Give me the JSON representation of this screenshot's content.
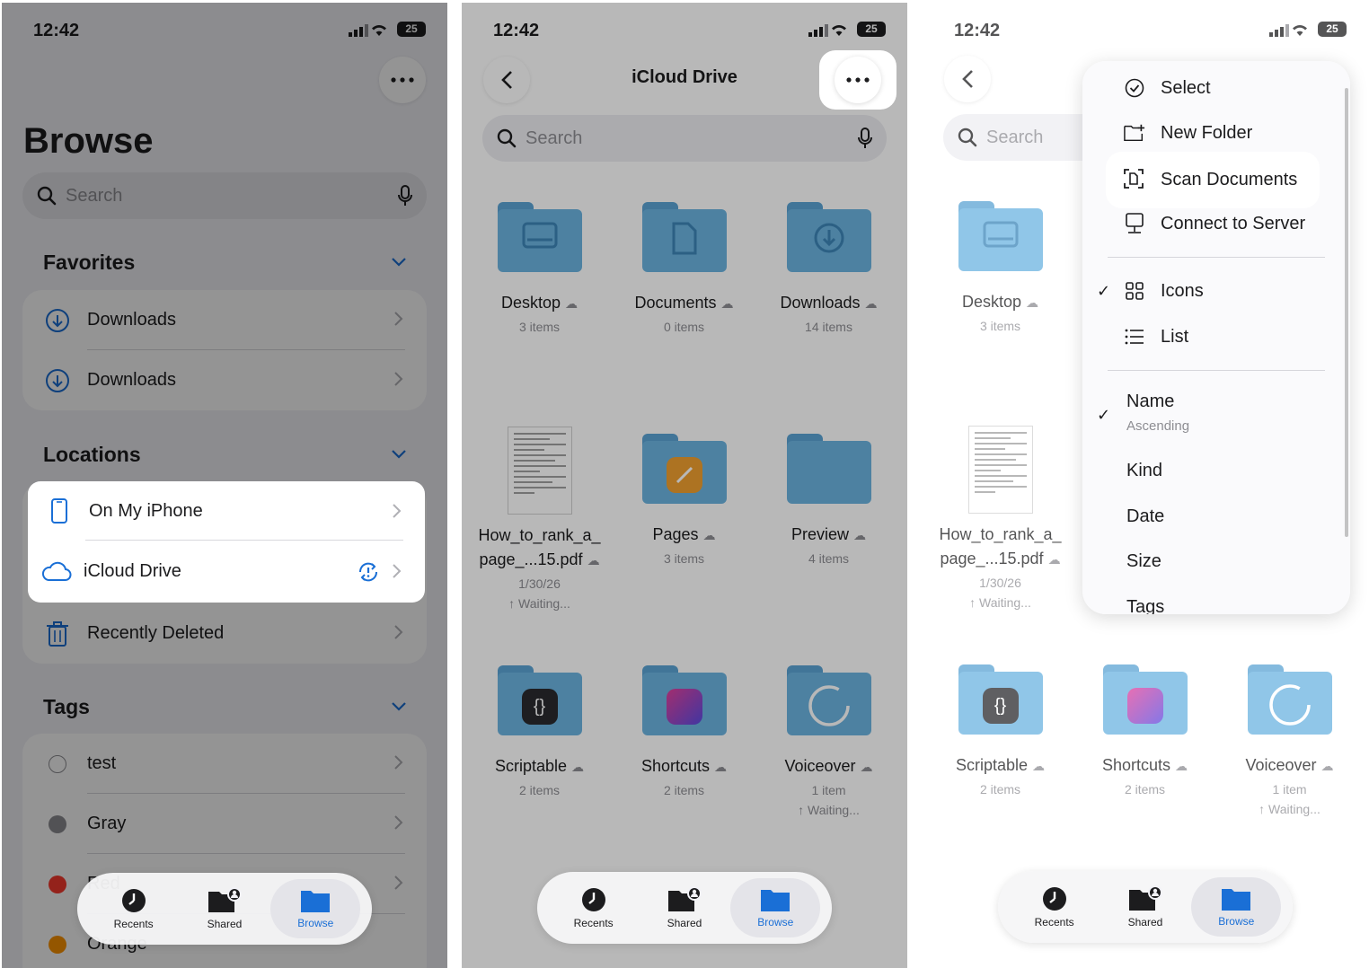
{
  "status": {
    "time": "12:42",
    "battery": "25"
  },
  "browse": {
    "title": "Browse",
    "search_placeholder": "Search",
    "favorites": {
      "heading": "Favorites",
      "items": [
        {
          "label": "Downloads"
        },
        {
          "label": "Downloads"
        }
      ]
    },
    "locations": {
      "heading": "Locations",
      "items": [
        {
          "label": "On My iPhone"
        },
        {
          "label": "iCloud Drive"
        },
        {
          "label": "Recently Deleted"
        }
      ]
    },
    "tags": {
      "heading": "Tags",
      "items": [
        {
          "label": "test",
          "color": "#ffffff"
        },
        {
          "label": "Gray",
          "color": "#8e8e93"
        },
        {
          "label": "Red",
          "color": "#ff3b30"
        },
        {
          "label": "Orange",
          "color": "#ff9500"
        }
      ]
    }
  },
  "tabbar": {
    "recents": "Recents",
    "shared": "Shared",
    "browse": "Browse"
  },
  "icloud": {
    "title": "iCloud Drive",
    "search_placeholder": "Search",
    "items": [
      {
        "name": "Desktop",
        "sub": "3 items"
      },
      {
        "name": "Documents",
        "sub": "0 items"
      },
      {
        "name": "Downloads",
        "sub": "14 items"
      },
      {
        "name_line1": "How_to_rank_a_",
        "name_line2": "page_...15.pdf",
        "date": "1/30/26",
        "status": "↑ Waiting..."
      },
      {
        "name": "Pages",
        "sub": "3 items"
      },
      {
        "name": "Preview",
        "sub": "4 items"
      },
      {
        "name": "Scriptable",
        "sub": "2 items"
      },
      {
        "name": "Shortcuts",
        "sub": "2 items"
      },
      {
        "name": "Voiceover",
        "sub": "1 item",
        "status": "↑ Waiting..."
      }
    ]
  },
  "menu": {
    "items": [
      {
        "label": "Select"
      },
      {
        "label": "New Folder"
      },
      {
        "label": "Scan Documents"
      },
      {
        "label": "Connect to Server"
      },
      {
        "label": "Icons",
        "checked": "✓"
      },
      {
        "label": "List"
      },
      {
        "label": "Name",
        "sublabel": "Ascending",
        "checked": "✓"
      },
      {
        "label": "Kind"
      },
      {
        "label": "Date"
      },
      {
        "label": "Size"
      },
      {
        "label": "Tags"
      }
    ]
  },
  "colors": {
    "accent": "#1a6fd6",
    "folder": "#6bb3e0"
  }
}
